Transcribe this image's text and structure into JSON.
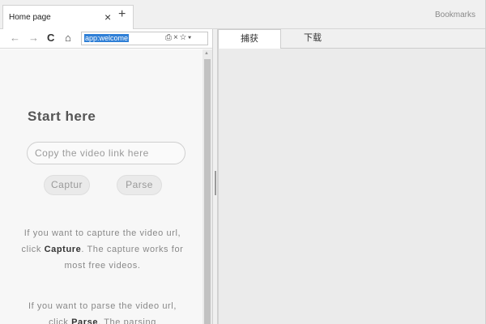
{
  "tabs": [
    {
      "title": "Home page",
      "close": "×"
    }
  ],
  "new_tab": "+",
  "bookmarks": "Bookmarks",
  "nav": {
    "back": "←",
    "forward": "→",
    "reload": "C",
    "home": "⌂",
    "address": "app:welcome",
    "icons": "⎙×☆▾"
  },
  "welcome": {
    "heading": "Start here",
    "input_placeholder": "Copy the video link here",
    "capture_label": "Captur",
    "parse_label": "Parse",
    "para1": [
      "If you want to capture the video url, click ",
      "Capture",
      ". The capture works for most free videos."
    ],
    "para2": [
      "If you want to parse the video url, click ",
      "Parse",
      ". The parsing"
    ]
  },
  "right_panel": {
    "tabs": [
      "捕获",
      "下载"
    ],
    "active_tab": 0
  },
  "colors": {
    "address_highlight": "#2f7fd6",
    "scroll_thumb": "#c2c2c2"
  }
}
